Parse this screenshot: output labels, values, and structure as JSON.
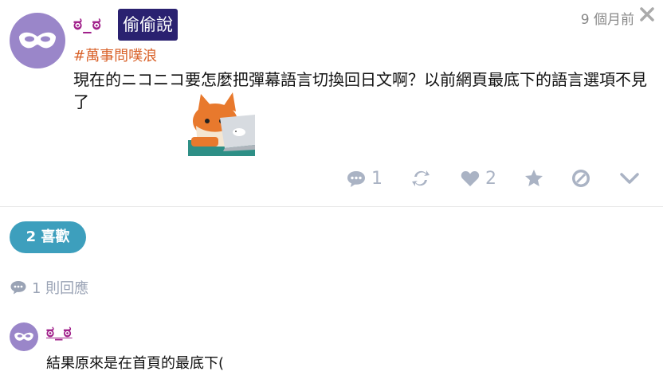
{
  "post": {
    "username": "ಠ_ಠ",
    "badge": "偷偷說",
    "time": "9 個月前",
    "tag": "#萬事問噗浪",
    "content": "現在的ニコニコ要怎麼把彈幕語言切換回日文啊？以前網頁最底下的語言選項不見了",
    "sticker_icon": "fox-laptop-sticker",
    "avatar_icon": "mask-icon"
  },
  "actions": {
    "reply_count": "1",
    "like_count": "2",
    "icons": [
      "comment-icon",
      "replurk-icon",
      "heart-icon",
      "star-icon",
      "mute-icon",
      "chevron-down-icon"
    ]
  },
  "likes": {
    "label": "2 喜歡"
  },
  "replies": {
    "count_label": "1 則回應",
    "items": [
      {
        "username": "ಠ_ಠ",
        "text": "結果原來是在首頁的最底下("
      }
    ]
  },
  "colors": {
    "username": "#a0208a",
    "badge_bg": "#2a2170",
    "tag": "#d9622a",
    "like_pill": "#3d9fbd",
    "action_icon": "#aab3c4",
    "avatar_bg": "#9a86c9"
  }
}
